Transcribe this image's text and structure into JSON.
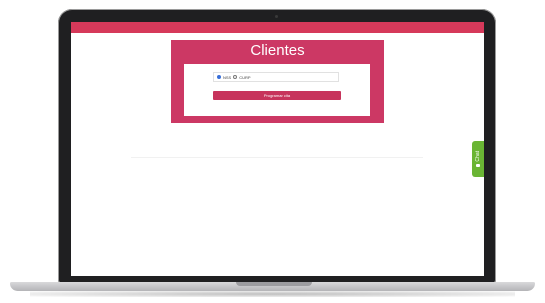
{
  "app": {
    "title": "Clientes"
  },
  "form": {
    "radio_options": [
      {
        "label": "NSS",
        "checked": true
      },
      {
        "label": "CURP",
        "checked": false
      }
    ],
    "submit_label": "Programar cita"
  },
  "chat": {
    "label": "Chat",
    "icon": "chat-icon"
  },
  "colors": {
    "brand": "#cc3864",
    "top_bar": "#d6395a",
    "chat": "#6ab534"
  }
}
